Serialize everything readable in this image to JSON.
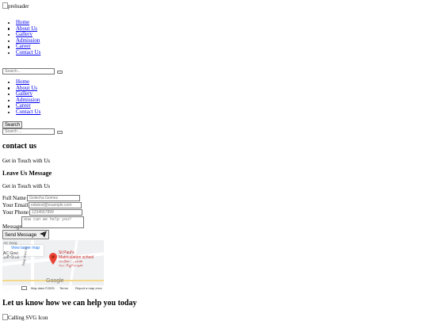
{
  "preloader_alt": "preloader",
  "nav_items": [
    "Home",
    "About Us",
    "Gallery",
    "Admission",
    "Career",
    "Contact Us"
  ],
  "search1_placeholder": "Search...",
  "search_button": "Search",
  "search2_placeholder": "Search ...",
  "page": {
    "heading": "contact us",
    "subtitle": "Get in Touch with Us"
  },
  "form": {
    "heading": "Leave Us Message",
    "subtitle": "Get in Touch with Us",
    "name_label": "Full Name",
    "name_placeholder": "Golecha Gomez",
    "email_label": "Your Email",
    "email_placeholder": "edubod@example.com",
    "phone_label": "Your Phone",
    "phone_placeholder": "1234567899",
    "message_label": "Message",
    "message_placeholder": "How can we help you?",
    "send_label": "Send Message"
  },
  "map": {
    "view_larger": "View larger map",
    "place_name": "St Paul's\nMatriculation school",
    "place_local": "செயின்ட் பால்ஸ்\nமெட்ரிகுலேஷன்",
    "left_label_1": "AC Gurg",
    "left_label_2": "AC Govi.",
    "left_local": "ஏசி மெக்",
    "road_label": "Pillai Manz St",
    "google": "Google",
    "footer_data": "Map data ©2025",
    "footer_terms": "Terms",
    "footer_report": "Report a map error"
  },
  "cta_heading": "Let us know how we can help you today",
  "calling_alt": "Calling SVG Icon"
}
